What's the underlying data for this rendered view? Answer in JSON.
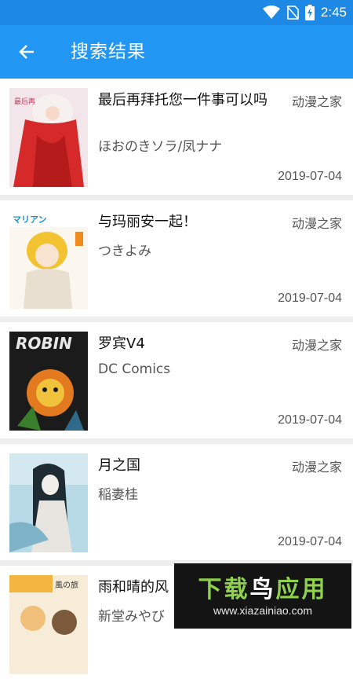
{
  "status_bar": {
    "time": "2:45"
  },
  "app_bar": {
    "title": "搜索结果",
    "back_icon": "arrow-back-icon"
  },
  "results": [
    {
      "title": "最后再拜托您一件事可以吗",
      "author": "ほおのきソラ/凤ナナ",
      "source": "动漫之家",
      "date": "2019-07-04"
    },
    {
      "title": "与玛丽安一起！",
      "author": "つきよみ",
      "source": "动漫之家",
      "date": "2019-07-04"
    },
    {
      "title": "罗宾V4",
      "author": "DC Comics",
      "source": "动漫之家",
      "date": "2019-07-04"
    },
    {
      "title": "月之国",
      "author": "稲妻桂",
      "source": "动漫之家",
      "date": "2019-07-04"
    },
    {
      "title": "雨和晴的风",
      "author": "新堂みやび"
    }
  ],
  "watermark": {
    "title_green": "下载",
    "title_white": "鸟",
    "title_green2": "应用",
    "url": "www.xiazainiao.com"
  },
  "colors": {
    "primary": "#2196f3",
    "primary_dark": "#1e88e5",
    "background": "#eeeeee"
  }
}
